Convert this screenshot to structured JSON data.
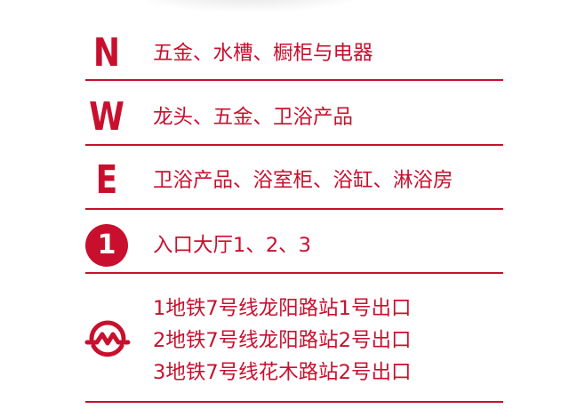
{
  "directions": [
    {
      "marker": "N",
      "text": "五金、水槽、橱柜与电器"
    },
    {
      "marker": "W",
      "text": "龙头、五金、卫浴产品"
    },
    {
      "marker": "E",
      "text": "卫浴产品、浴室柜、浴缸、淋浴房"
    }
  ],
  "entrance": {
    "marker": "1",
    "text": "入口大厅1、2、3"
  },
  "metro": {
    "icon": "shanghai-metro-icon",
    "lines": [
      "1地铁7号线龙阳路站1号出口",
      "2地铁7号线龙阳路站2号出口",
      "3地铁7号线花木路站2号出口"
    ]
  },
  "colors": {
    "accent": "#c8102e",
    "background": "#ffffff"
  }
}
